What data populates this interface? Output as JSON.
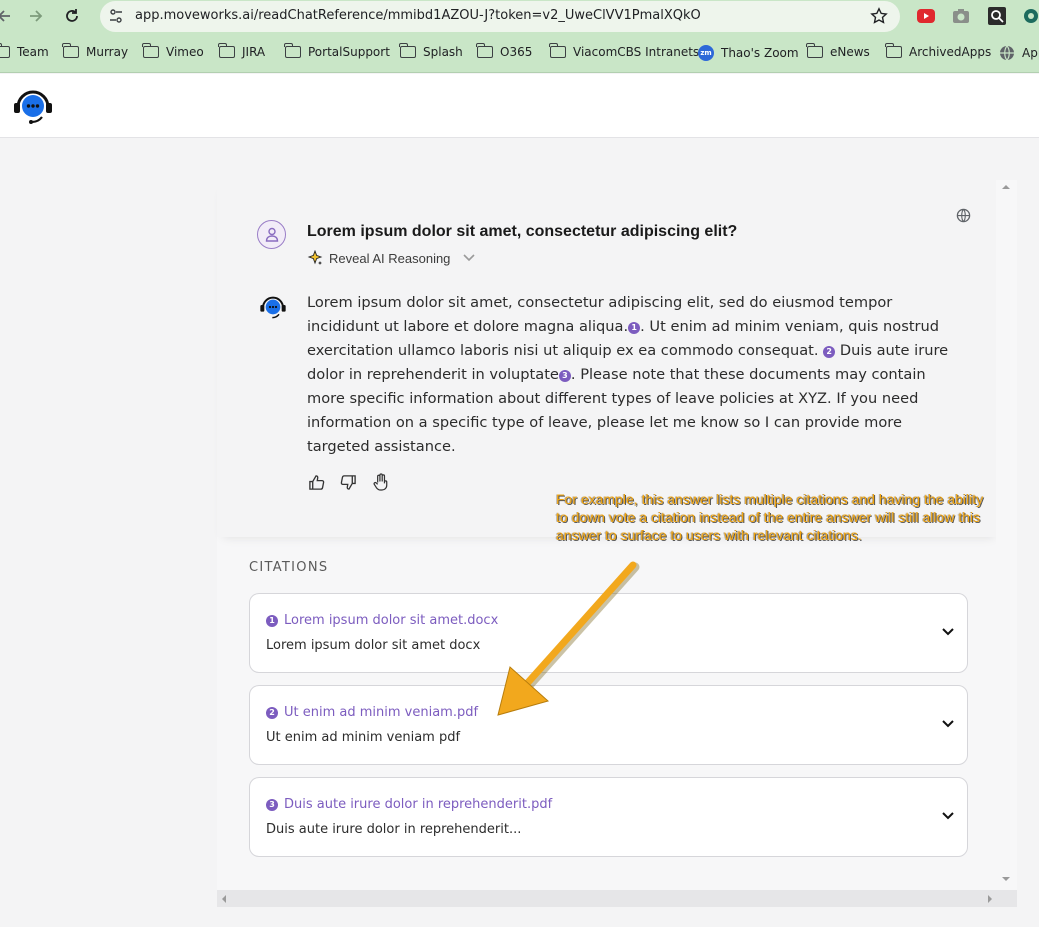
{
  "browser": {
    "url": "app.moveworks.ai/readChatReference/mmibd1AZOU-J?token=v2_UweClVV1PmalXQkO",
    "bookmarks": [
      {
        "label": "Team",
        "icon": "folder-icon"
      },
      {
        "label": "Murray",
        "icon": "folder-icon"
      },
      {
        "label": "Vimeo",
        "icon": "folder-icon"
      },
      {
        "label": "JIRA",
        "icon": "folder-icon"
      },
      {
        "label": "PortalSupport",
        "icon": "folder-icon"
      },
      {
        "label": "Splash",
        "icon": "folder-icon"
      },
      {
        "label": "O365",
        "icon": "folder-icon"
      },
      {
        "label": "ViacomCBS Intranets",
        "icon": "folder-icon"
      },
      {
        "label": "Thao's Zoom",
        "icon": "zoom-icon"
      },
      {
        "label": "eNews",
        "icon": "folder-icon"
      },
      {
        "label": "ArchivedApps",
        "icon": "folder-icon"
      },
      {
        "label": "App",
        "icon": "globe-icon"
      }
    ],
    "zoom_badge": "zm"
  },
  "chat": {
    "question": "Lorem ipsum dolor sit amet, consectetur adipiscing elit?",
    "reveal_label": "Reveal AI Reasoning",
    "answer": {
      "s1": "Lorem ipsum dolor sit amet, consectetur adipiscing elit, sed do eiusmod tempor incididunt ut labore et dolore magna aliqua.",
      "c1": "1",
      "s2": ". Ut enim ad minim veniam, quis nostrud exercitation ullamco laboris nisi ut aliquip ex ea commodo consequat. ",
      "c2": "2",
      "s3": " Duis aute irure dolor in reprehenderit in voluptate",
      "c3": "3",
      "s4": ". Please note that these documents may contain more specific information about different types of leave policies at XYZ. If you need information on a specific type of leave, please let me know so I can provide more targeted assistance."
    }
  },
  "citations": {
    "heading": "CITATIONS",
    "items": [
      {
        "number": "1",
        "title": "Lorem ipsum dolor sit amet.docx",
        "subtitle": "Lorem ipsum dolor sit amet docx"
      },
      {
        "number": "2",
        "title": "Ut enim ad minim veniam.pdf",
        "subtitle": "Ut enim ad minim veniam pdf"
      },
      {
        "number": "3",
        "title": "Duis aute irure dolor in reprehenderit.pdf",
        "subtitle": "Duis aute irure dolor in reprehenderit..."
      }
    ]
  },
  "annotation": {
    "text": "For example, this answer lists multiple citations and having the ability to down vote a citation instead of the entire answer will still allow this answer to surface to users with relevant citations.",
    "color": "#f1a40e"
  },
  "colors": {
    "toolbar": "#c9e6c7",
    "accent": "#7c5cbf",
    "brand": "#1a6fe8"
  }
}
